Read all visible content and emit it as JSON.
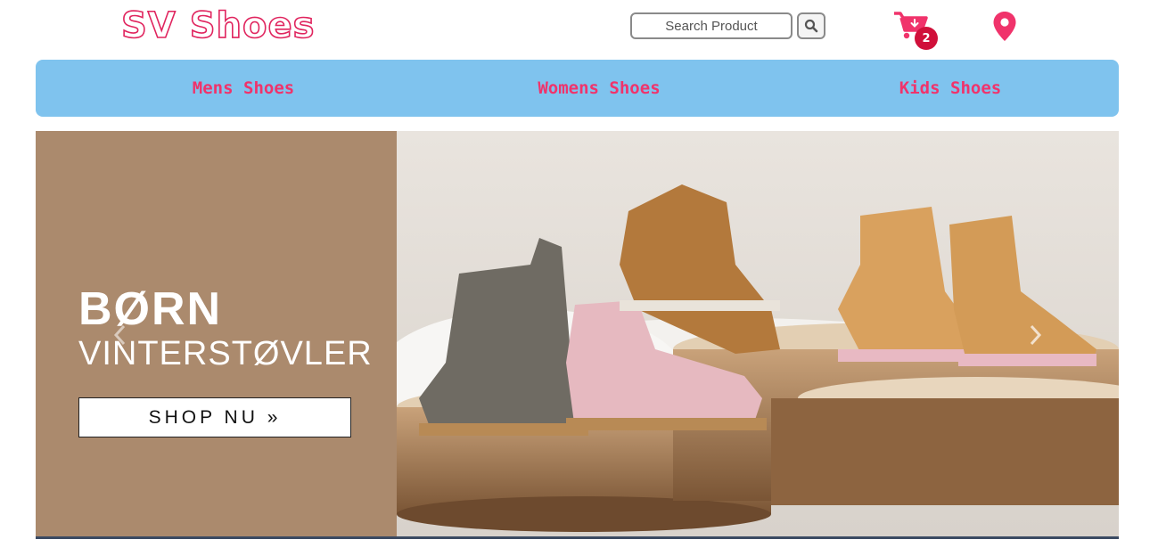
{
  "header": {
    "logo_text": "SV Shoes",
    "search": {
      "placeholder": "Search Product",
      "value": ""
    },
    "search_button_icon": "search-icon",
    "cart": {
      "icon": "cart-download-icon",
      "count": "2"
    },
    "location_icon": "map-pin-icon"
  },
  "nav": {
    "items": [
      {
        "label": "Mens Shoes"
      },
      {
        "label": "Womens Shoes"
      },
      {
        "label": "Kids Shoes"
      }
    ]
  },
  "hero": {
    "title_line1": "BØRN",
    "title_line2": "VINTERSTØVLER",
    "cta_label": "SHOP NU »",
    "prev_icon": "chevron-left-icon",
    "next_icon": "chevron-right-icon",
    "background_color": "#ab8a6d"
  },
  "colors": {
    "accent_pink": "#f0336b",
    "nav_blue": "#7fc3ee",
    "badge_red": "#d0103a"
  }
}
